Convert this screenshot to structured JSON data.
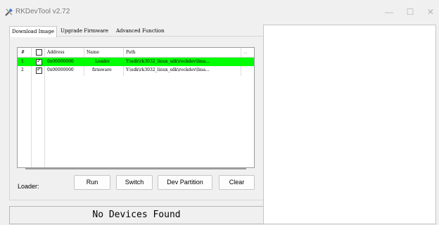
{
  "window": {
    "title": "RKDevTool v2.72",
    "minimize": "—",
    "maximize": "☐",
    "close": "✕"
  },
  "tabs": [
    {
      "label": "Download Image"
    },
    {
      "label": "Upgrade Firmware"
    },
    {
      "label": "Advanced Function"
    }
  ],
  "table": {
    "headers": {
      "num": "#",
      "address": "Address",
      "name": "Name",
      "path": "Path",
      "more": "..."
    },
    "rows": [
      {
        "num": "1",
        "checked": true,
        "address": "0x00000000",
        "name": "Loader",
        "path": "Y:\\sdk\\rk3032_linux_sdk\\rockdev\\Ima...",
        "selected": true
      },
      {
        "num": "2",
        "checked": true,
        "address": "0x00000000",
        "name": "firmware",
        "path": "Y:\\sdk\\rk3032_linux_sdk\\rockdev\\Ima...",
        "selected": false
      }
    ]
  },
  "bottom": {
    "loader_label": "Loader:",
    "run": "Run",
    "switch": "Switch",
    "dev_partition": "Dev Partition",
    "clear": "Clear"
  },
  "status": "No Devices Found",
  "colors": {
    "selected_row": "#00ff00"
  }
}
